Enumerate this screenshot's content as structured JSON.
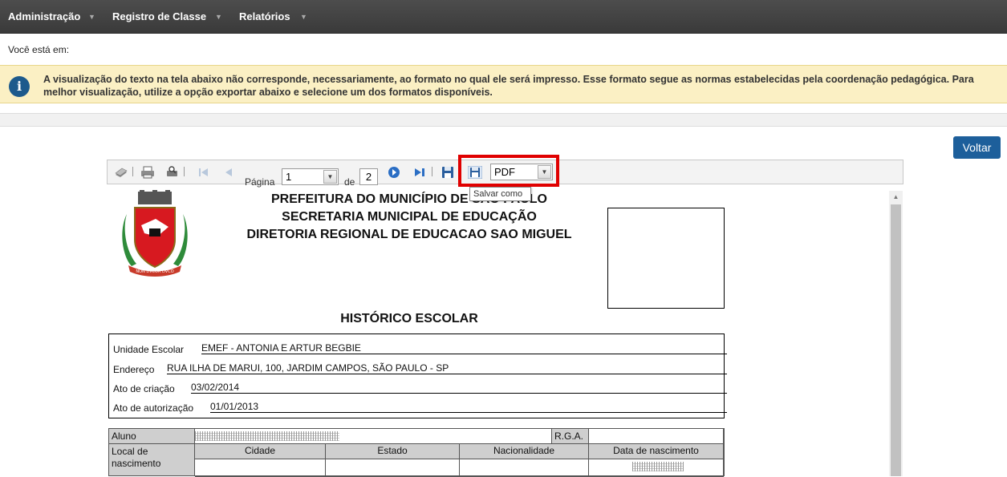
{
  "nav": {
    "items": [
      {
        "label": "Administração"
      },
      {
        "label": "Registro de Classe"
      },
      {
        "label": "Relatórios"
      }
    ],
    "caret": "▼"
  },
  "breadcrumb": "Você está em:",
  "info": {
    "icon": "info-icon",
    "text": "A visualização do texto na tela abaixo não corresponde, necessariamente, ao formato no qual ele será impresso. Esse formato segue as normas estabelecidas pela coordenação pedagógica. Para melhor visualização, utilize a opção exportar abaixo e selecione um dos formatos disponíveis."
  },
  "back_button": "Voltar",
  "toolbar": {
    "page_label": "Página",
    "page_value": "1",
    "of_label": "de",
    "page_total": "2",
    "format_value": "PDF",
    "tooltip": "Salvar como"
  },
  "report": {
    "header": [
      "PREFEITURA DO MUNICÍPIO DE SÃO PAULO",
      "SECRETARIA MUNICIPAL DE EDUCAÇÃO",
      "DIRETORIA REGIONAL DE EDUCACAO SAO MIGUEL"
    ],
    "crest_motto": "NON DVCOR DVCO",
    "title": "HISTÓRICO ESCOLAR",
    "school": {
      "unit_label": "Unidade Escolar",
      "unit_value": "EMEF - ANTONIA E ARTUR BEGBIE",
      "address_label": "Endereço",
      "address_value": "RUA ILHA DE MARUI, 100, JARDIM CAMPOS, SÃO PAULO - SP",
      "creation_label": "Ato de criação",
      "creation_value": "03/02/2014",
      "authorization_label": "Ato de autorização",
      "authorization_value": "01/01/2013"
    },
    "student": {
      "student_label": "Aluno",
      "rga_label": "R.G.A.",
      "birthplace_label": "Local de nascimento",
      "city_label": "Cidade",
      "state_label": "Estado",
      "nationality_label": "Nacionalidade",
      "birthdate_label": "Data de nascimento"
    }
  }
}
